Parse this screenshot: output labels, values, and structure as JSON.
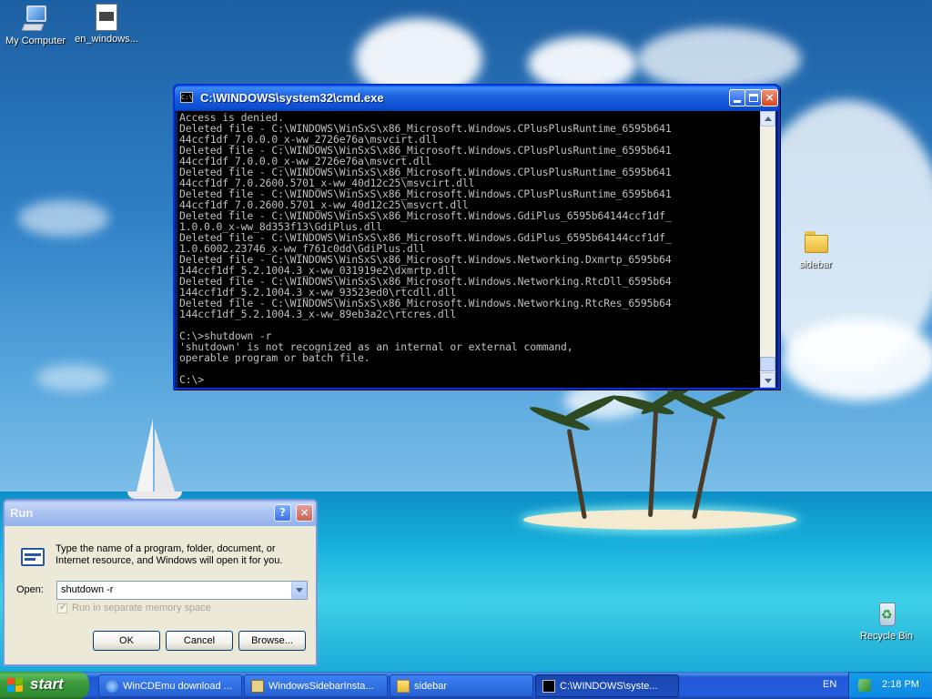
{
  "desktop": {
    "icons": [
      {
        "label": "My Computer"
      },
      {
        "label": "en_windows..."
      },
      {
        "label": "sidebar"
      },
      {
        "label": "Recycle Bin"
      }
    ]
  },
  "cmd_window": {
    "title": "C:\\WINDOWS\\system32\\cmd.exe",
    "lines": [
      "Access is denied.",
      "Deleted file - C:\\WINDOWS\\WinSxS\\x86_Microsoft.Windows.CPlusPlusRuntime_6595b641",
      "44ccf1df_7.0.0.0_x-ww_2726e76a\\msvcirt.dll",
      "Deleted file - C:\\WINDOWS\\WinSxS\\x86_Microsoft.Windows.CPlusPlusRuntime_6595b641",
      "44ccf1df_7.0.0.0_x-ww_2726e76a\\msvcrt.dll",
      "Deleted file - C:\\WINDOWS\\WinSxS\\x86_Microsoft.Windows.CPlusPlusRuntime_6595b641",
      "44ccf1df_7.0.2600.5701_x-ww_40d12c25\\msvcirt.dll",
      "Deleted file - C:\\WINDOWS\\WinSxS\\x86_Microsoft.Windows.CPlusPlusRuntime_6595b641",
      "44ccf1df_7.0.2600.5701_x-ww_40d12c25\\msvcrt.dll",
      "Deleted file - C:\\WINDOWS\\WinSxS\\x86_Microsoft.Windows.GdiPlus_6595b64144ccf1df_",
      "1.0.0.0_x-ww_8d353f13\\GdiPlus.dll",
      "Deleted file - C:\\WINDOWS\\WinSxS\\x86_Microsoft.Windows.GdiPlus_6595b64144ccf1df_",
      "1.0.6002.23746_x-ww_f761c0dd\\GdiPlus.dll",
      "Deleted file - C:\\WINDOWS\\WinSxS\\x86_Microsoft.Windows.Networking.Dxmrtp_6595b64",
      "144ccf1df_5.2.1004.3_x-ww_031919e2\\dxmrtp.dll",
      "Deleted file - C:\\WINDOWS\\WinSxS\\x86_Microsoft.Windows.Networking.RtcDll_6595b64",
      "144ccf1df_5.2.1004.3_x-ww_93523ed0\\rtcdll.dll",
      "Deleted file - C:\\WINDOWS\\WinSxS\\x86_Microsoft.Windows.Networking.RtcRes_6595b64",
      "144ccf1df_5.2.1004.3_x-ww_89eb3a2c\\rtcres.dll",
      "",
      "C:\\>shutdown -r",
      "'shutdown' is not recognized as an internal or external command,",
      "operable program or batch file.",
      "",
      "C:\\>"
    ],
    "min_glyph": "",
    "max_glyph": "",
    "close_glyph": "×"
  },
  "run_dialog": {
    "title": "Run",
    "help_glyph": "?",
    "close_glyph": "×",
    "description": "Type the name of a program, folder, document, or Internet resource, and Windows will open it for you.",
    "open_label": "Open:",
    "open_value": "shutdown -r",
    "checkbox_label": "Run in separate memory space",
    "checkbox_checked": true,
    "ok_label": "OK",
    "cancel_label": "Cancel",
    "browse_label": "Browse..."
  },
  "taskbar": {
    "start_label": "start",
    "tasks": [
      {
        "label": "WinCDEmu download ..."
      },
      {
        "label": "WindowsSidebarInsta..."
      },
      {
        "label": "sidebar"
      },
      {
        "label": "C:\\WINDOWS\\syste..."
      }
    ],
    "language": "EN",
    "clock": "2:18 PM"
  }
}
